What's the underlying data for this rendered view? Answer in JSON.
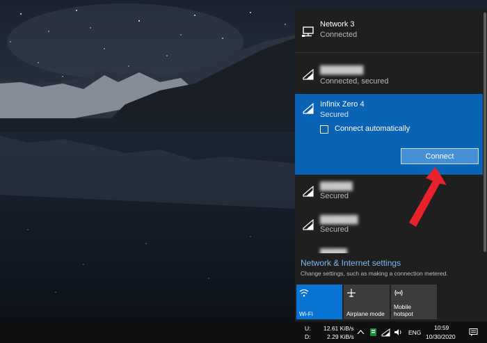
{
  "flyout": {
    "networks": [
      {
        "name": "Network 3",
        "status": "Connected",
        "type": "ethernet"
      },
      {
        "name": "████████",
        "status": "Connected, secured",
        "type": "wifi",
        "name_obscured": true
      },
      {
        "name": "Infinix Zero 4",
        "status": "Secured",
        "type": "wifi",
        "selected": true
      },
      {
        "name": "██████",
        "status": "Secured",
        "type": "wifi",
        "name_obscured": true
      },
      {
        "name": "███████",
        "status": "Secured",
        "type": "wifi",
        "name_obscured": true
      },
      {
        "name": "█████",
        "status": "",
        "type": "wifi",
        "name_obscured": true,
        "partially_visible": true
      }
    ],
    "connect_auto_label": "Connect automatically",
    "connect_auto_checked": false,
    "connect_button_label": "Connect",
    "settings_link": "Network & Internet settings",
    "settings_desc": "Change settings, such as making a connection metered.",
    "tiles": [
      {
        "label": "Wi-Fi",
        "icon": "wifi-icon",
        "active": true
      },
      {
        "label": "Airplane mode",
        "icon": "airplane-icon",
        "active": false
      },
      {
        "label": "Mobile\nhotspot",
        "icon": "hotspot-icon",
        "active": false
      }
    ]
  },
  "taskbar": {
    "upload_label": "U:",
    "download_label": "D:",
    "upload_speed": "12.61 KiB/s",
    "download_speed": "2.29 KiB/s",
    "language": "ENG",
    "time": "10:59",
    "date": "10/30/2020"
  },
  "colors": {
    "selected_network_bg": "#0a63b4",
    "active_tile_bg": "#0a74d4",
    "flyout_bg": "#1f1f1f",
    "link": "#7fb9f0",
    "arrow": "#e8222b"
  }
}
